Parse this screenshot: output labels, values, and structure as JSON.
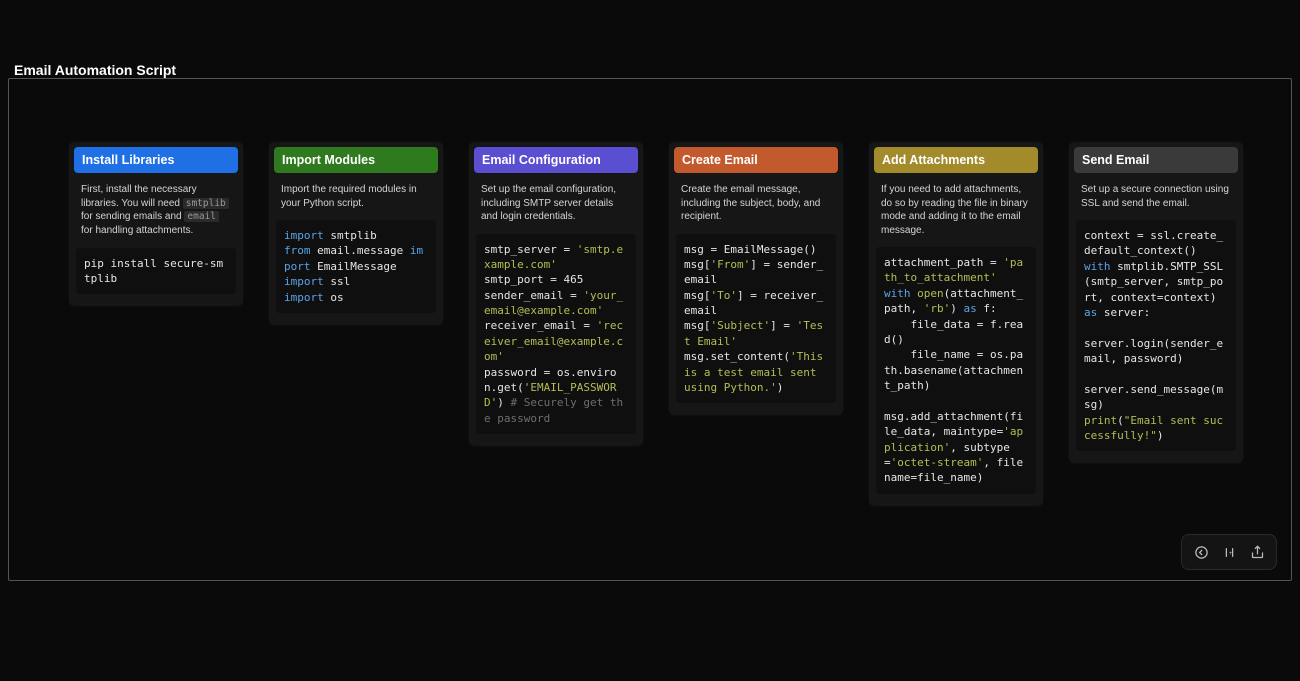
{
  "page_title": "Email Automation Script",
  "cards": [
    {
      "header": "Install Libraries",
      "header_class": "hdr-blue",
      "desc_html": "First, install the necessary libraries. You will need <span class='inline-code'>smtplib</span> for sending emails and <span class='inline-code'>email</span> for handling attachments.",
      "code_html": "pip install secure-smtplib"
    },
    {
      "header": "Import Modules",
      "header_class": "hdr-green",
      "desc_html": "Import the required modules in your Python script.",
      "code_html": "<span class='tok-kw'>import</span> smtplib\n<span class='tok-kw'>from</span> email.message <span class='tok-kw'>import</span> EmailMessage\n<span class='tok-kw'>import</span> ssl\n<span class='tok-kw'>import</span> os"
    },
    {
      "header": "Email Configuration",
      "header_class": "hdr-purple",
      "desc_html": "Set up the email configuration, including SMTP server details and login credentials.",
      "code_html": "smtp_server = <span class='tok-str'>'smtp.example.com'</span>\nsmtp_port = 465\nsender_email = <span class='tok-str'>'your_email@example.com'</span>\nreceiver_email = <span class='tok-str'>'receiver_email@example.com'</span>\npassword = os.environ.get(<span class='tok-str'>'EMAIL_PASSWORD'</span>) <span class='tok-cmt'># Securely get the password</span>"
    },
    {
      "header": "Create Email",
      "header_class": "hdr-red",
      "desc_html": "Create the email message, including the subject, body, and recipient.",
      "code_html": "msg = EmailMessage()\nmsg[<span class='tok-str'>'From'</span>] = sender_email\nmsg[<span class='tok-str'>'To'</span>] = receiver_email\nmsg[<span class='tok-str'>'Subject'</span>] = <span class='tok-str'>'Test Email'</span>\nmsg.set_content(<span class='tok-str'>'This is a test email sent using Python.'</span>)"
    },
    {
      "header": "Add Attachments",
      "header_class": "hdr-olive",
      "desc_html": "If you need to add attachments, do so by reading the file in binary mode and adding it to the email message.",
      "code_html": "attachment_path = <span class='tok-str'>'path_to_attachment'</span>\n<span class='tok-kw'>with</span> <span class='tok-fn'>open</span>(attachment_path, <span class='tok-str'>'rb'</span>) <span class='tok-kw'>as</span> f:\n    file_data = f.read()\n    file_name = os.path.basename(attachment_path)\n\nmsg.add_attachment(file_data, maintype=<span class='tok-str'>'application'</span>, subtype=<span class='tok-str'>'octet-stream'</span>, filename=file_name)"
    },
    {
      "header": "Send Email",
      "header_class": "hdr-gray",
      "desc_html": "Set up a secure connection using SSL and send the email.",
      "code_html": "context = ssl.create_default_context()\n<span class='tok-kw'>with</span> smtplib.SMTP_SSL(smtp_server, smtp_port, context=context) <span class='tok-kw'>as</span> server:\n\nserver.login(sender_email, password)\n\nserver.send_message(msg)\n<span class='tok-fn'>print</span>(<span class='tok-str'>\"Email sent successfully!\"</span>)"
    }
  ],
  "toolbar": {
    "back_label": "back",
    "step_label": "step",
    "share_label": "share"
  }
}
